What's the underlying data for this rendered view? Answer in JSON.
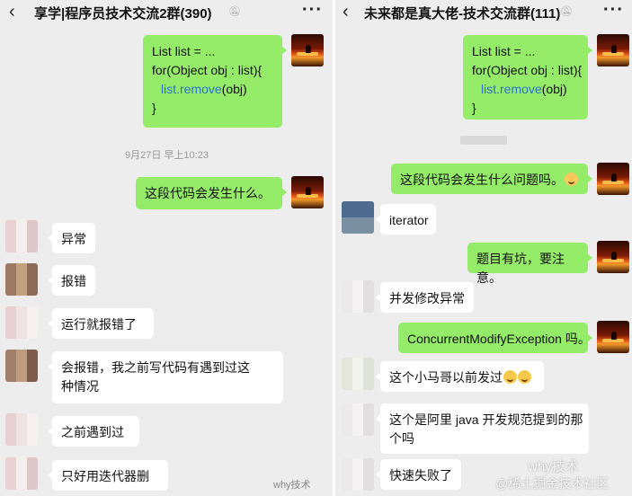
{
  "left": {
    "header": {
      "back_icon": "back-arrow-icon",
      "title": "享学|程序员技术交流2群(390)",
      "more_label": "···"
    },
    "code_message": {
      "lines": [
        "List list = ...",
        "for(Object obj : list){",
        "list.remove(obj)",
        "}"
      ],
      "code_prefix": "",
      "method": "list.remove",
      "args": "(obj)"
    },
    "timestamp": "9月27日 早上10:23",
    "question": "这段代码会发生什么。",
    "replies": [
      "异常",
      "报错",
      "运行就报错了",
      "会报错，我之前写代码有遇到过这种情况",
      "之前遇到过",
      "只好用迭代器删"
    ],
    "reply_wrap": [
      "会报错，我之前写代码有遇到过这",
      "种情况"
    ],
    "watermark": "why技术"
  },
  "right": {
    "header": {
      "back_icon": "back-arrow-icon",
      "title": "未来都是真大佬-技术交流群(111)",
      "more_label": "···"
    },
    "code_message": {
      "lines": [
        "List list = ...",
        "for(Object obj : list){",
        "list.remove(obj)",
        "}"
      ],
      "method": "list.remove",
      "args": "(obj)"
    },
    "messages": [
      {
        "side": "self",
        "text": "这段代码会发生什么问题吗。"
      },
      {
        "side": "other",
        "text": "iterator"
      },
      {
        "side": "self",
        "text": "题目有坑，要注意。"
      },
      {
        "side": "other",
        "text": "并发修改异常"
      },
      {
        "side": "self",
        "text": "ConcurrentModifyException 吗。"
      },
      {
        "side": "other",
        "text": "这个小马哥以前发过"
      },
      {
        "side": "other",
        "text": "这个是阿里 java 开发规范提到的那个吗"
      },
      {
        "side": "other",
        "text": "快速失败了"
      }
    ],
    "wrap": [
      "这个是阿里 java 开发规范提到的那",
      "个吗"
    ],
    "watermark": "@稀土掘金技术社区",
    "watermark2": "why技术"
  },
  "colors": {
    "green_bubble": "#95ec69",
    "white_bubble": "#ffffff",
    "background": "#ededed",
    "method": "#2e74c6"
  }
}
